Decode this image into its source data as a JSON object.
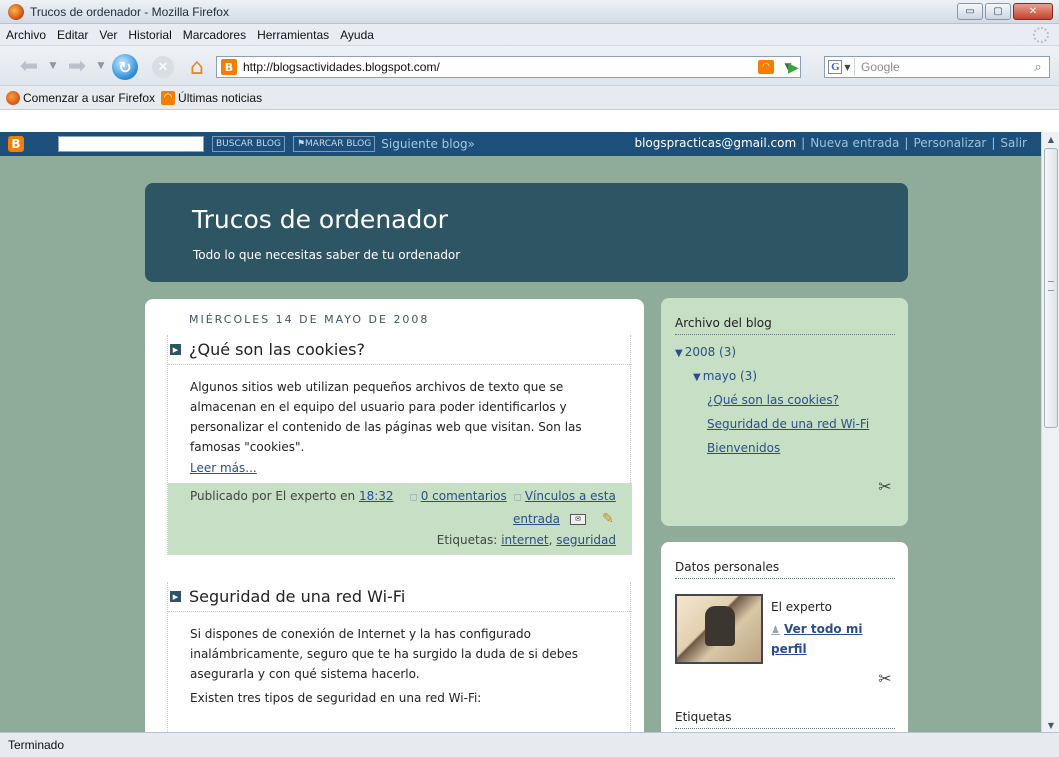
{
  "window": {
    "title": "Trucos de ordenador - Mozilla Firefox",
    "min_btn": "▭",
    "max_btn": "▢",
    "close_btn": "✕"
  },
  "menu": [
    "Archivo",
    "Editar",
    "Ver",
    "Historial",
    "Marcadores",
    "Herramientas",
    "Ayuda"
  ],
  "navigation": {
    "url": "http://blogsactividades.blogspot.com/",
    "search_placeholder": "Google",
    "search_engine_letter": "G"
  },
  "bookmarks": [
    {
      "label": "Comenzar a usar Firefox",
      "icon": "firefox-icon"
    },
    {
      "label": "Últimas noticias",
      "icon": "rss-icon"
    }
  ],
  "blogger_bar": {
    "logo_letter": "B",
    "search_button": "BUSCAR BLOG",
    "flag_button": "⚑MARCAR BLOG",
    "next_blog": "Siguiente blog»",
    "email": "blogspracticas@gmail.com",
    "new_post": "Nueva entrada",
    "customize": "Personalizar",
    "sign_out": "Salir"
  },
  "blog": {
    "title": "Trucos de ordenador",
    "description": "Todo lo que necesitas saber de tu ordenador",
    "date_header": "MIÉRCOLES 14 DE MAYO DE 2008",
    "posts": [
      {
        "title": "¿Qué son las cookies?",
        "body": "Algunos sitios web utilizan pequeños archivos de texto que se almacenan en el equipo del usuario para poder identificarlos y personalizar el contenido de las páginas web que visitan. Son las famosas \"cookies\".",
        "read_more": "Leer más...",
        "posted_by": "Publicado por El experto en",
        "time": "18:32",
        "comments": "0 comentarios",
        "links_part1": "Vínculos a esta",
        "links_part2": "entrada",
        "labels_prefix": "Etiquetas:",
        "label1": "internet",
        "label2": "seguridad"
      },
      {
        "title": "Seguridad de una red Wi-Fi",
        "body": "Si dispones de conexión de Internet y la has configurado inalámbricamente, seguro que te ha surgido la duda de si debes asegurarla y con qué sistema hacerlo.",
        "body2": "Existen tres tipos de seguridad en una red Wi-Fi:"
      }
    ]
  },
  "sidebar": {
    "archive_title": "Archivo del blog",
    "year": "2008 (3)",
    "month": "mayo (3)",
    "archive_posts": [
      "¿Qué son las cookies?",
      "Seguridad de una red Wi-Fi",
      "Bienvenidos"
    ],
    "profile_title": "Datos personales",
    "profile_name": "El experto",
    "profile_link": "Ver todo mi perfil",
    "labels_title": "Etiquetas"
  },
  "status": "Terminado"
}
